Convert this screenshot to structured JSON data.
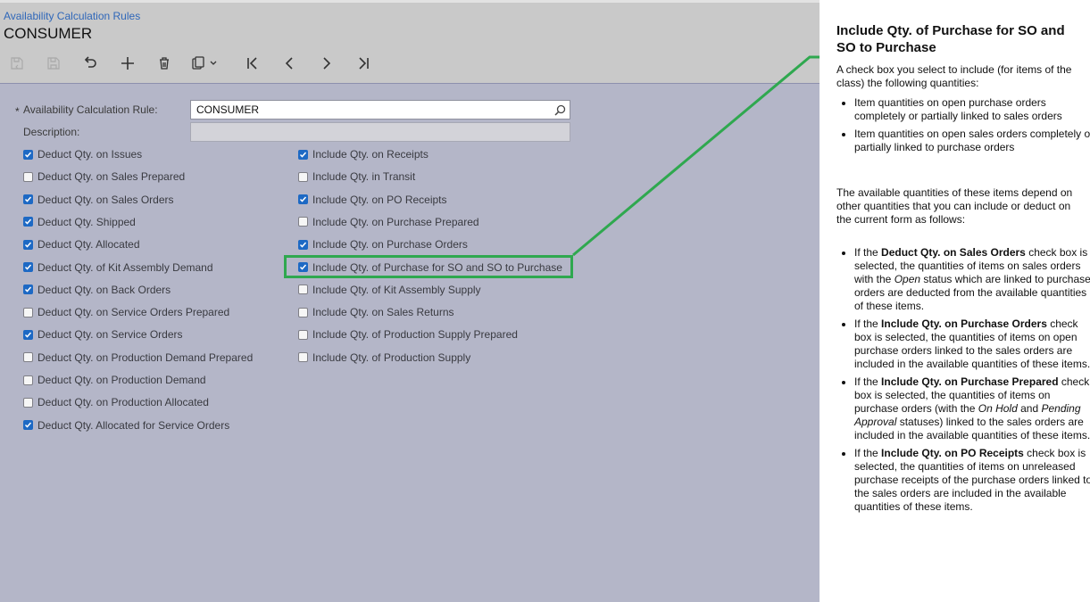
{
  "breadcrumb": "Availability Calculation Rules",
  "page_title": "CONSUMER",
  "toolbar": [
    "save-as-icon",
    "save-icon",
    "undo-icon",
    "add-icon",
    "delete-icon",
    "copy-paste-icon",
    "first-record-icon",
    "previous-record-icon",
    "next-record-icon",
    "last-record-icon"
  ],
  "form": {
    "rule_label": "Availability Calculation Rule:",
    "rule_value": "CONSUMER",
    "description_label": "Description:",
    "description_value": ""
  },
  "left_checkboxes": [
    {
      "label": "Deduct Qty. on Issues",
      "checked": true
    },
    {
      "label": "Deduct Qty. on Sales Prepared",
      "checked": false
    },
    {
      "label": "Deduct Qty. on Sales Orders",
      "checked": true
    },
    {
      "label": "Deduct Qty. Shipped",
      "checked": true
    },
    {
      "label": "Deduct Qty. Allocated",
      "checked": true
    },
    {
      "label": "Deduct Qty. of Kit Assembly Demand",
      "checked": true
    },
    {
      "label": "Deduct Qty. on Back Orders",
      "checked": true
    },
    {
      "label": "Deduct Qty. on Service Orders Prepared",
      "checked": false
    },
    {
      "label": "Deduct Qty. on Service Orders",
      "checked": true
    },
    {
      "label": "Deduct Qty. on Production Demand Prepared",
      "checked": false
    },
    {
      "label": "Deduct Qty. on Production Demand",
      "checked": false
    },
    {
      "label": "Deduct Qty. on Production Allocated",
      "checked": false
    },
    {
      "label": "Deduct Qty. Allocated for Service Orders",
      "checked": true
    }
  ],
  "right_checkboxes": [
    {
      "label": "Include Qty. on Receipts",
      "checked": true
    },
    {
      "label": "Include Qty. in Transit",
      "checked": false
    },
    {
      "label": "Include Qty. on PO Receipts",
      "checked": true
    },
    {
      "label": "Include Qty. on Purchase Prepared",
      "checked": false
    },
    {
      "label": "Include Qty. on Purchase Orders",
      "checked": true
    },
    {
      "label": "Include Qty. of Purchase for SO and SO to Purchase",
      "checked": true
    },
    {
      "label": "Include Qty. of Kit Assembly Supply",
      "checked": false
    },
    {
      "label": "Include Qty. on Sales Returns",
      "checked": false
    },
    {
      "label": "Include Qty. of Production Supply Prepared",
      "checked": false
    },
    {
      "label": "Include Qty. of Production Supply",
      "checked": false
    }
  ],
  "help": {
    "title": "Include Qty. of Purchase for SO and SO to Purchase",
    "intro": "A check box you select to include (for items of the class) the following quantities:",
    "bullets1": [
      "Item quantities on open purchase orders completely or partially linked to sales orders",
      "Item quantities on open sales orders completely or partially linked to purchase orders"
    ],
    "middle": "The available quantities of these items depend on other quantities that you can include or deduct on the current form as follows:",
    "b1": {
      "a": "If the ",
      "b": "Deduct Qty. on Sales Orders",
      "c": " check box is selected, the quantities of items on sales orders with the ",
      "d": "Open",
      "e": " status which are linked to purchase orders are deducted from the available quantities of these items."
    },
    "b2": {
      "a": "If the ",
      "b": "Include Qty. on Purchase Orders",
      "c": " check box is selected, the quantities of items on open purchase orders linked to the sales orders are included in the available quantities of these items."
    },
    "b3": {
      "a": "If the ",
      "b": "Include Qty. on Purchase Prepared",
      "c": " check box is selected, the quantities of items on purchase orders (with the ",
      "d": "On Hold",
      "e": " and ",
      "f": "Pending Approval",
      "g": " statuses) linked to the sales orders are included in the available quantities of these items."
    },
    "b4": {
      "a": "If the ",
      "b": "Include Qty. on PO Receipts",
      "c": " check box is selected, the quantities of items on unreleased purchase receipts of the purchase orders linked to the sales orders are included in the available quantities of these items."
    }
  },
  "colors": {
    "accent": "#1d69c4",
    "highlight": "#2fa84f",
    "panel": "#b4b6c8"
  }
}
